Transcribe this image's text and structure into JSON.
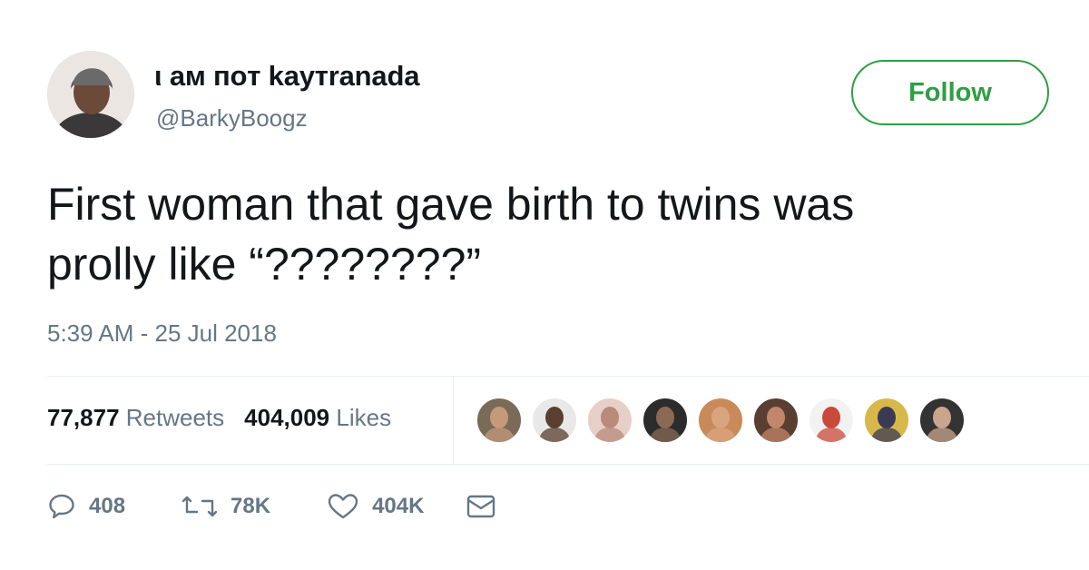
{
  "tweet": {
    "display_name": "ι aм пoт kayтranada",
    "handle": "@BarkyBoogz",
    "text_line1": "First woman that gave birth to twins was",
    "text_line2": "prolly like “????????”",
    "timestamp": "5:39 AM - 25 Jul 2018"
  },
  "follow_button": {
    "label": "Follow",
    "color": "#2f9e44"
  },
  "stats": {
    "retweets_count": "77,877",
    "retweets_label": "Retweets",
    "likes_count": "404,009",
    "likes_label": "Likes"
  },
  "liker_avatars": [
    {
      "bg": "#7a6a58",
      "skin": "#c49a7a"
    },
    {
      "bg": "#e8e8e8",
      "skin": "#5a3f2c"
    },
    {
      "bg": "#e6cfc6",
      "skin": "#b88a7a"
    },
    {
      "bg": "#2c2c2c",
      "skin": "#8a6a55"
    },
    {
      "bg": "#c98a5a",
      "skin": "#d9a580"
    },
    {
      "bg": "#5a3e32",
      "skin": "#c2876a"
    },
    {
      "bg": "#f2f2f2",
      "skin": "#c94a3a"
    },
    {
      "bg": "#d8b84a",
      "skin": "#3a3a55"
    },
    {
      "bg": "#333333",
      "skin": "#c9a58d"
    }
  ],
  "actions": {
    "reply_count": "408",
    "retweet_count": "78K",
    "like_count": "404K"
  },
  "icons": {
    "reply": "reply-icon",
    "retweet": "retweet-icon",
    "like": "heart-icon",
    "message": "envelope-icon"
  }
}
